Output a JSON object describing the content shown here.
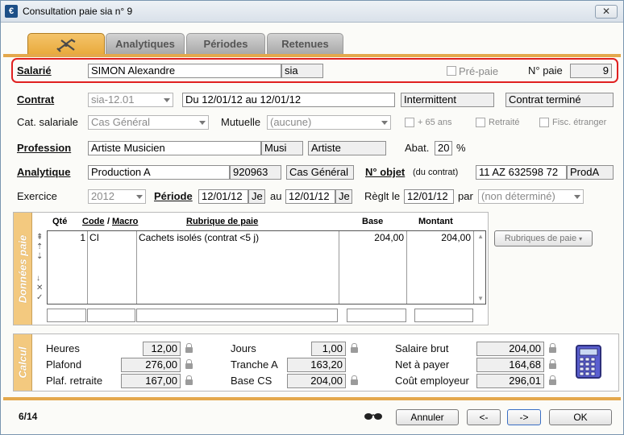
{
  "window": {
    "title": "Consultation paie sia n° 9",
    "close_label": "✕"
  },
  "tabs": [
    {
      "label": ""
    },
    {
      "label": "Analytiques"
    },
    {
      "label": "Périodes"
    },
    {
      "label": "Retenues"
    }
  ],
  "salarie": {
    "label": "Salarié",
    "name": "SIMON Alexandre",
    "code": "sia",
    "prepaie_label": "Pré-paie",
    "npaie_label": "N° paie",
    "npaie": "9"
  },
  "contrat": {
    "label": "Contrat",
    "value": "sia-12.01",
    "dates": "Du 12/01/12 au 12/01/12",
    "type": "Intermittent",
    "status": "Contrat terminé"
  },
  "cat": {
    "label": "Cat. salariale",
    "value": "Cas Général",
    "mutuelle_label": "Mutuelle",
    "mutuelle": "(aucune)",
    "plus65": "+ 65 ans",
    "retraite": "Retraité",
    "fisc": "Fisc. étranger"
  },
  "profession": {
    "label": "Profession",
    "value": "Artiste Musicien",
    "code": "Musi",
    "type": "Artiste",
    "abat_label": "Abat.",
    "abat": "20",
    "abat_unit": "%"
  },
  "analytique": {
    "label": "Analytique",
    "value": "Production A",
    "code": "920963",
    "cat": "Cas Général",
    "nobjet_label": "N° objet",
    "nobjet_sub": "(du contrat)",
    "nobjet": "11 AZ 632598 72",
    "nobjet_code": "ProdA"
  },
  "exercice": {
    "label": "Exercice",
    "value": "2012",
    "periode_label": "Période",
    "from": "12/01/12",
    "from_day": "Je",
    "au": "au",
    "to": "12/01/12",
    "to_day": "Je",
    "reglt_label": "Règlt le",
    "reglt": "12/01/12",
    "par_label": "par",
    "par": "(non déterminé)"
  },
  "donnees": {
    "side_label": "Données paie",
    "headers": {
      "qte": "Qté",
      "code": "Code",
      "slash": "/",
      "macro": "Macro",
      "rubrique": "Rubrique de paie",
      "base": "Base",
      "montant": "Montant"
    },
    "rows": [
      {
        "qte": "1",
        "code": "CI",
        "rubrique": "Cachets isolés (contrat <5 j)",
        "base": "204,00",
        "montant": "204,00"
      }
    ],
    "rubriques_btn": "Rubriques de paie"
  },
  "calcul": {
    "side_label": "Calcul",
    "heures_label": "Heures",
    "heures": "12,00",
    "plafond_label": "Plafond",
    "plafond": "276,00",
    "plaf_ret_label": "Plaf. retraite",
    "plaf_ret": "167,00",
    "jours_label": "Jours",
    "jours": "1,00",
    "tranche_label": "Tranche A",
    "tranche": "163,20",
    "basecs_label": "Base CS",
    "basecs": "204,00",
    "brut_label": "Salaire brut",
    "brut": "204,00",
    "net_label": "Net à payer",
    "net": "164,68",
    "cout_label": "Coût employeur",
    "cout": "296,01"
  },
  "footer": {
    "pager": "6/14",
    "annuler": "Annuler",
    "prev": "<-",
    "next": "->",
    "ok": "OK"
  }
}
